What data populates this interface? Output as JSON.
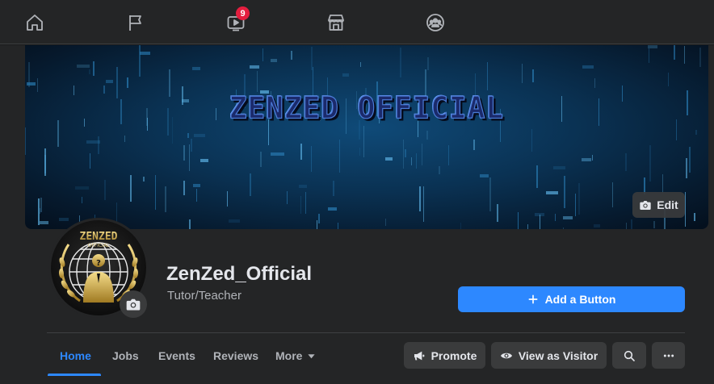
{
  "nav": {
    "items": [
      {
        "icon": "home-icon"
      },
      {
        "icon": "flag-icon"
      },
      {
        "icon": "watch-video-icon",
        "badge": "9"
      },
      {
        "icon": "marketplace-store-icon"
      },
      {
        "icon": "groups-icon"
      }
    ]
  },
  "cover": {
    "title_text": "ZENZED OFFICIAL",
    "edit_label": "Edit"
  },
  "avatar": {
    "logo_top_text": "ZENZED",
    "logo_sub_text": "OFFICIAL"
  },
  "page": {
    "name": "ZenZed_Official",
    "category": "Tutor/Teacher",
    "add_button_label": "Add a Button"
  },
  "tabs": [
    {
      "label": "Home",
      "active": true
    },
    {
      "label": "Jobs"
    },
    {
      "label": "Events"
    },
    {
      "label": "Reviews"
    },
    {
      "label": "More"
    }
  ],
  "actions": {
    "promote_label": "Promote",
    "view_as_visitor_label": "View as Visitor"
  },
  "colors": {
    "accent": "#2d88ff",
    "surface": "#242526",
    "background": "#18191a",
    "badge": "#e41e3f"
  }
}
